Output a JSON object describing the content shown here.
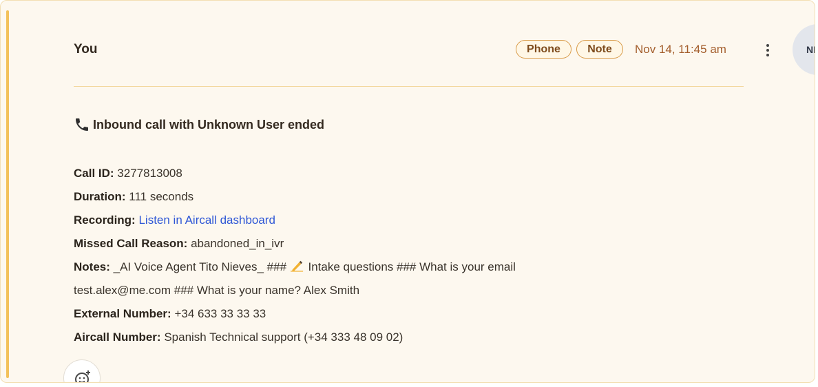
{
  "header": {
    "author": "You",
    "tags": [
      "Phone",
      "Note"
    ],
    "timestamp": "Nov 14, 11:45 am",
    "avatar_initials": "NM"
  },
  "body": {
    "headline": "Inbound call with Unknown User ended",
    "fields": {
      "call_id": {
        "label": "Call ID:",
        "value": "3277813008"
      },
      "duration": {
        "label": "Duration:",
        "value": "111 seconds"
      },
      "recording": {
        "label": "Recording:",
        "link_text": "Listen in Aircall dashboard"
      },
      "missed_reason": {
        "label": "Missed Call Reason:",
        "value": "abandoned_in_ivr"
      },
      "notes": {
        "label": "Notes:",
        "value_part1": "_AI Voice Agent Tito Nieves_ ### ",
        "value_part2": " Intake questions ### What is your email",
        "value_line2": "test.alex@me.com ### What is your name? Alex Smith"
      },
      "external_number": {
        "label": "External Number:",
        "value": "+34 633 33 33 33"
      },
      "aircall_number": {
        "label": "Aircall Number:",
        "value": "Spanish Technical support (+34 333 48 09 02)"
      }
    }
  },
  "icons": {
    "headline": "phone-receiver-icon",
    "notes_emoji": "writing-hand-icon",
    "reaction": "add-reaction-icon",
    "menu": "more-vertical-icon"
  },
  "colors": {
    "card_background": "#fdf8ef",
    "accent_bar": "#f3c15a",
    "tag_border": "#d89a47",
    "timestamp": "#a35d2b",
    "link": "#2f57d6"
  }
}
